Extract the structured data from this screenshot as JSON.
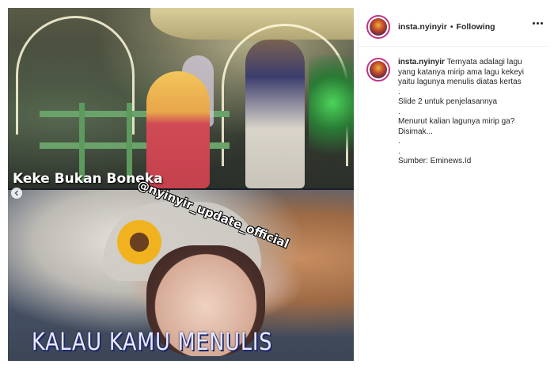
{
  "media": {
    "top_caption": "Keke Bukan Boneka",
    "watermark": "@nyinyir_update_official",
    "bottom_caption": "KALAU KAMU MENULIS",
    "carousel_dots": 2,
    "active_dot": 0
  },
  "header": {
    "username": "insta.nyinyir",
    "separator": "•",
    "follow_status": "Following"
  },
  "caption": {
    "username": "insta.nyinyir",
    "lines": [
      "Ternyata adalagi lagu",
      "yang katanya mirip ama lagu kekeyi",
      "yaitu lagunya menulis diatas kertas",
      ".",
      "Slide 2 untuk penjelasannya",
      ".",
      "Menurut kalian lagunya mirip ga?",
      "Disimak...",
      ".",
      ".",
      "Sumber: Eminews.Id"
    ]
  },
  "colors": {
    "story_ring": "#c13584",
    "active_dot": "#3897f0",
    "text": "#262626",
    "divider": "#efefef"
  },
  "icons": {
    "more": "more-options-icon",
    "carousel_prev": "chevron-left-icon"
  }
}
